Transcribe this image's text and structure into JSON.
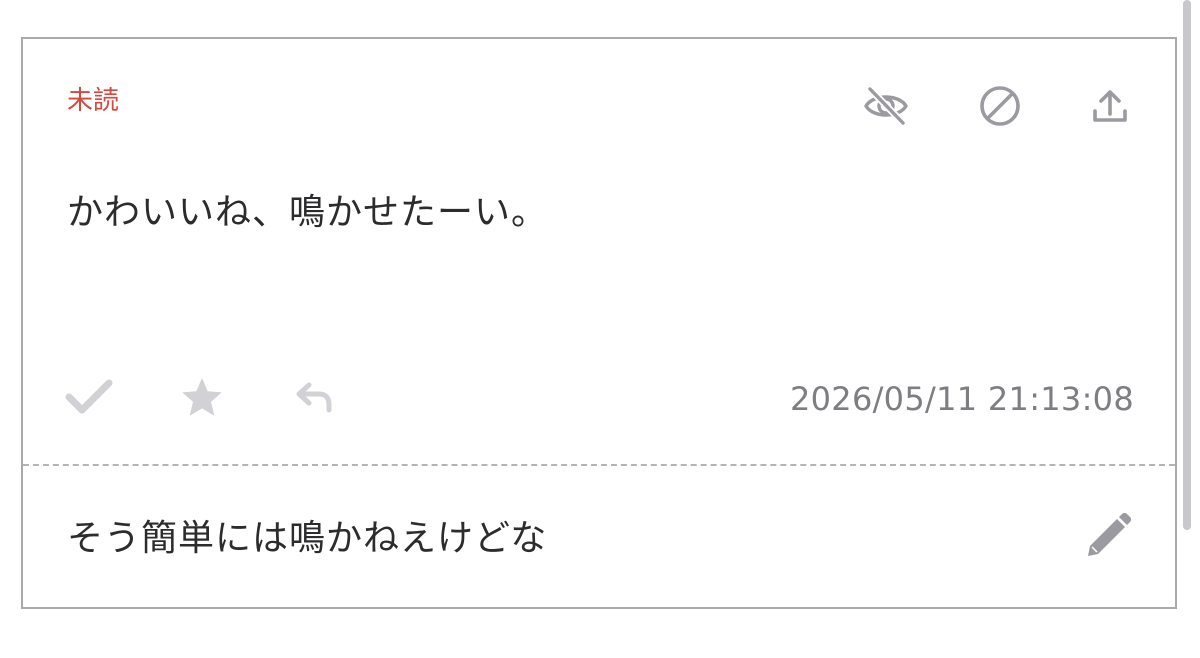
{
  "card": {
    "status_label": "未読",
    "message_text": "かわいいね、鳴かせたーい。",
    "timestamp": "2026/05/11 21:13:08",
    "comment_text": "そう簡単には鳴かねえけどな"
  },
  "icons": {
    "top": [
      "eye-off-icon",
      "block-icon",
      "share-icon"
    ],
    "actions": [
      "check-icon",
      "star-icon",
      "reply-icon"
    ],
    "comment": "pencil-icon"
  },
  "colors": {
    "status_red": "#d2493f",
    "icon_gray": "#9a9aa0",
    "action_icon_light": "#d1d1d6",
    "text_dark": "#2c2c2e",
    "timestamp_gray": "#7d7d82",
    "border": "#a9a9ae"
  }
}
